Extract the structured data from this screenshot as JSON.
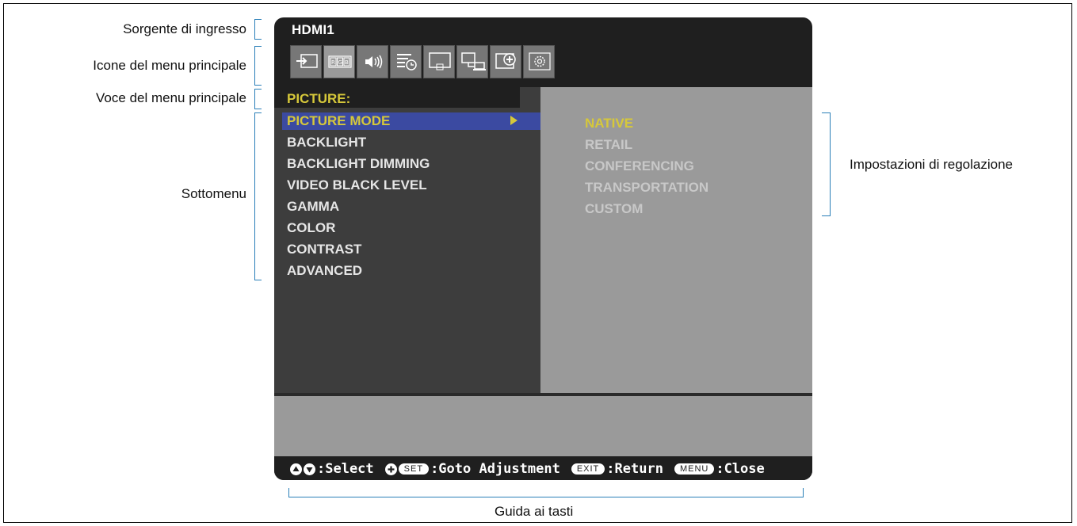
{
  "labels": {
    "input_source": "Sorgente di ingresso",
    "main_menu_icons": "Icone del menu principale",
    "main_menu_item": "Voce del menu principale",
    "submenu": "Sottomenu",
    "adjustment_settings": "Impostazioni di regolazione",
    "key_guide": "Guida ai tasti"
  },
  "osd": {
    "input_source": "HDMI1",
    "icons": [
      "input-icon",
      "rgb-icon",
      "audio-icon",
      "schedule-icon",
      "display-icon",
      "multi-display-icon",
      "protect-icon",
      "settings-icon"
    ],
    "selected_icon_index": 1,
    "category": "PICTURE:",
    "submenu": [
      "PICTURE MODE",
      "BACKLIGHT",
      "BACKLIGHT DIMMING",
      "VIDEO BLACK LEVEL",
      "GAMMA",
      "COLOR",
      "CONTRAST",
      "ADVANCED"
    ],
    "selected_submenu_index": 0,
    "options": [
      "NATIVE",
      "RETAIL",
      "CONFERENCING",
      "TRANSPORTATION",
      "CUSTOM"
    ],
    "selected_option_index": 0,
    "keyguide": {
      "select": ":Select",
      "set_key": "SET",
      "goto": ":Goto Adjustment",
      "exit_key": "EXIT",
      "return": ":Return",
      "menu_key": "MENU",
      "close": ":Close"
    }
  },
  "colors": {
    "highlight_text": "#d6c83a",
    "selection_bar": "#3b4aa1",
    "callout_bracket": "#2a7fb8"
  }
}
